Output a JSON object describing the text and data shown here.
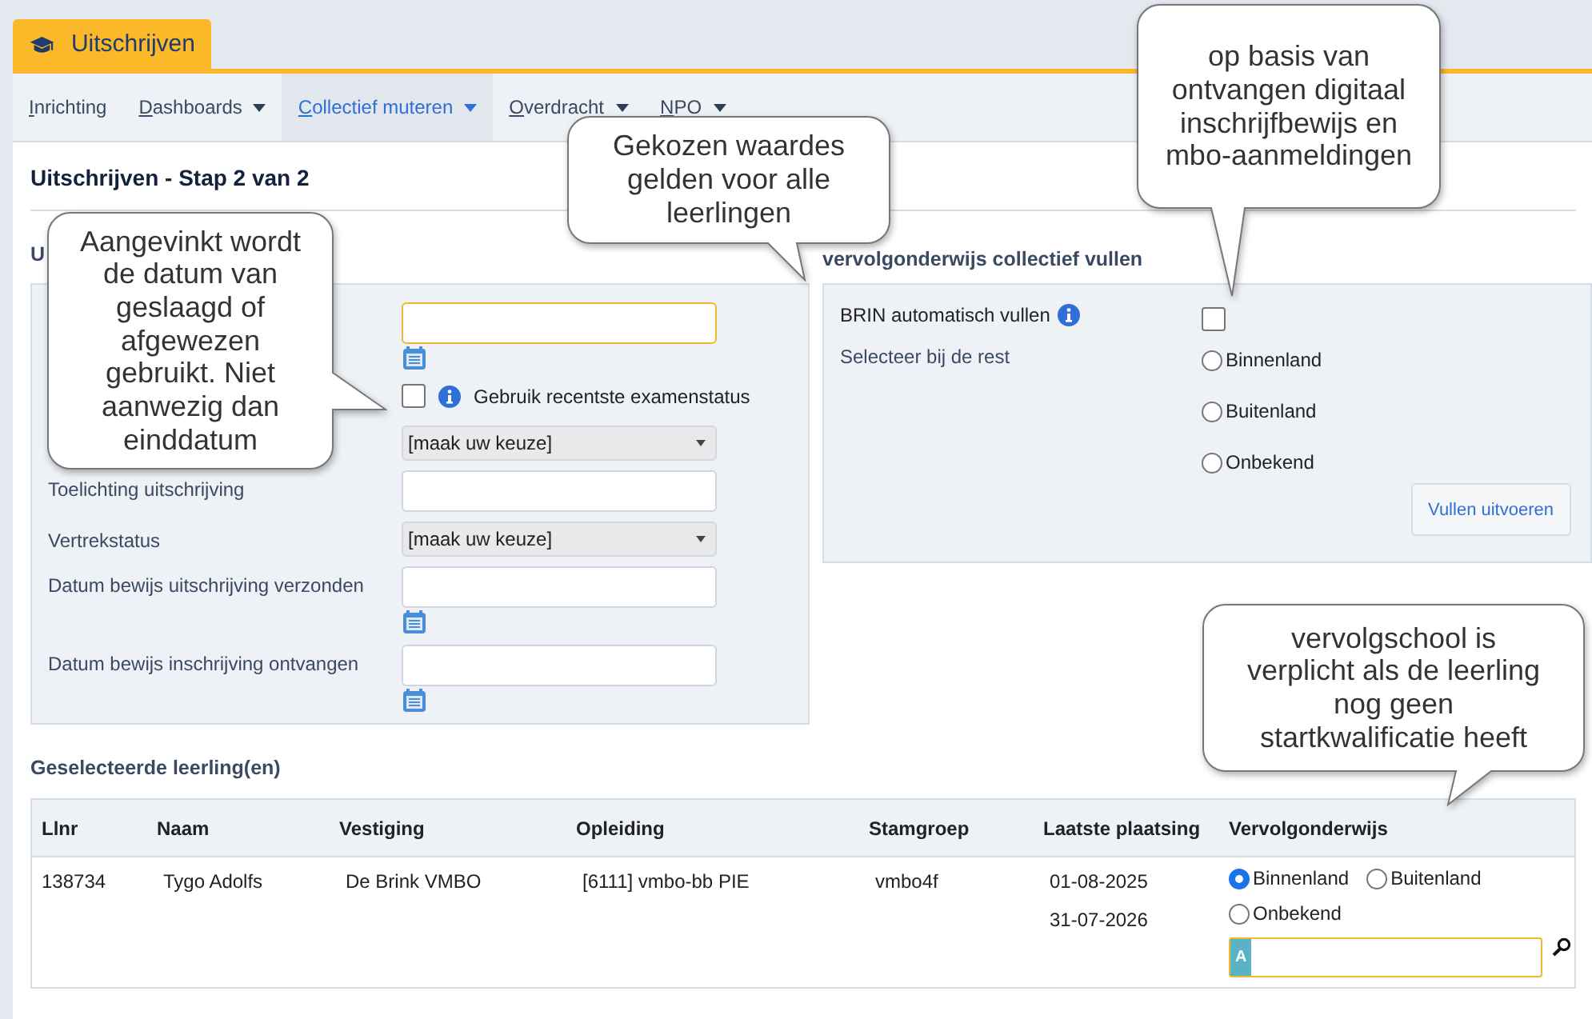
{
  "tab": {
    "label": "Uitschrijven",
    "selected": true
  },
  "nav": [
    {
      "label": "Inrichting",
      "dropdown": false,
      "selected": false
    },
    {
      "label": "Dashboards",
      "dropdown": true,
      "selected": false
    },
    {
      "label": "Collectief muteren",
      "dropdown": true,
      "selected": true
    },
    {
      "label": "Overdracht",
      "dropdown": true,
      "selected": false
    },
    {
      "label": "NPO",
      "dropdown": true,
      "selected": false
    }
  ],
  "page_title": "Uitschrijven - Stap 2 van 2",
  "left_section": {
    "title": "U",
    "fields": [
      {
        "kind": "date",
        "focused": true
      },
      {
        "kind": "checkbox",
        "text": "Gebruik recentste examenstatus",
        "checked": false
      },
      {
        "kind": "select",
        "value": "[maak uw keuze]"
      },
      {
        "kind": "text",
        "label": "Toelichting uitschrijving"
      },
      {
        "kind": "select",
        "label": "Vertrekstatus",
        "value": "[maak uw keuze]"
      },
      {
        "kind": "date",
        "label": "Datum bewijs uitschrijving verzonden",
        "focused": false
      },
      {
        "kind": "date",
        "label": "Datum bewijs inschrijving ontvangen",
        "focused": false
      }
    ]
  },
  "right_section": {
    "title": "vervolgonderwijs collectief vullen",
    "rows": [
      {
        "kind": "checkbox",
        "label": "BRIN automatisch vullen",
        "checked": false
      },
      {
        "kind": "radios",
        "label": "Selecteer bij de rest",
        "options": [
          {
            "label": "Binnenland",
            "selected": false
          },
          {
            "label": "Buitenland",
            "selected": false
          },
          {
            "label": "Onbekend",
            "selected": false
          }
        ]
      }
    ],
    "button": "Vullen uitvoeren"
  },
  "students": {
    "title": "Geselecteerde leerling(en)",
    "columns": [
      "Llnr",
      "Naam",
      "Vestiging",
      "Opleiding",
      "Stamgroep",
      "Laatste plaatsing",
      "Vervolgonderwijs"
    ],
    "rows": [
      {
        "llnr": "138734",
        "naam": "Tygo Adolfs",
        "vestiging": "De Brink VMBO",
        "opleiding": "[6111] vmbo-bb PIE",
        "stamgroep": "vmbo4f",
        "laatste_plaatsing": [
          "01-08-2025",
          "31-07-2026"
        ],
        "vervolgonderwijs": {
          "options": [
            {
              "label": "Binnenland",
              "selected": true
            },
            {
              "label": "Buitenland",
              "selected": false
            },
            {
              "label": "Onbekend",
              "selected": false
            }
          ],
          "search": {
            "badge": "A",
            "focused": true
          }
        }
      }
    ]
  },
  "callouts": [
    {
      "text": "Aangevinkt wordt\nde datum van\ngeslaagd of\nafgewezen\ngebruikt. Niet\naanwezig dan\neinddatum"
    },
    {
      "text": "Gekozen waardes\ngelden voor alle\nleerlingen"
    },
    {
      "text": "op basis van\nontvangen digitaal\ninschrijfbewijs en\nmbo-aanmeldingen"
    },
    {
      "text": "vervolgschool is\nverplicht als de leerling\nnog geen\nstartkwalificatie heeft"
    }
  ]
}
